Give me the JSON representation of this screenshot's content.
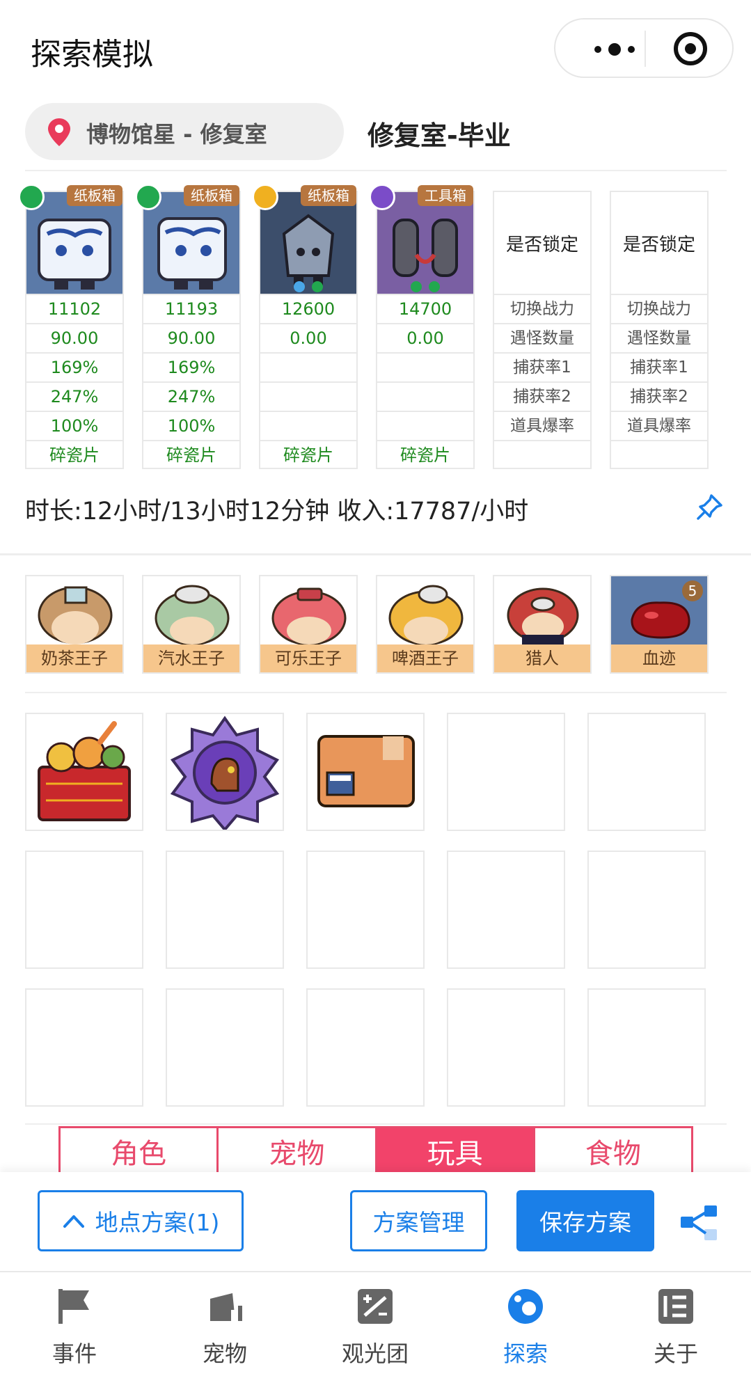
{
  "header": {
    "title": "探索模拟"
  },
  "location": {
    "name": "博物馆星 - 修复室",
    "plan_name": "修复室-毕业"
  },
  "toys": [
    {
      "tag": "纸板箱",
      "rarity_color": "#22a84f",
      "values": [
        "11102",
        "90.00",
        "169%",
        "247%",
        "100%",
        "碎瓷片"
      ]
    },
    {
      "tag": "纸板箱",
      "rarity_color": "#22a84f",
      "values": [
        "11193",
        "90.00",
        "169%",
        "247%",
        "100%",
        "碎瓷片"
      ]
    },
    {
      "tag": "纸板箱",
      "rarity_color": "#f0b020",
      "values": [
        "12600",
        "0.00",
        "",
        "",
        "",
        "碎瓷片"
      ]
    },
    {
      "tag": "工具箱",
      "rarity_color": "#7b4cc8",
      "values": [
        "14700",
        "0.00",
        "",
        "",
        "",
        "碎瓷片"
      ]
    }
  ],
  "lock_columns": [
    {
      "header": "是否锁定",
      "rows": [
        "切换战力",
        "遇怪数量",
        "捕获率1",
        "捕获率2",
        "道具爆率"
      ]
    },
    {
      "header": "是否锁定",
      "rows": [
        "切换战力",
        "遇怪数量",
        "捕获率1",
        "捕获率2",
        "道具爆率"
      ]
    }
  ],
  "status_line": "时长:12小时/13小时12分钟 收入:17787/小时",
  "pets": [
    {
      "label": "奶茶王子"
    },
    {
      "label": "汽水王子"
    },
    {
      "label": "可乐王子"
    },
    {
      "label": "啤酒王子"
    },
    {
      "label": "猎人"
    },
    {
      "label": "血迹",
      "badge": "5"
    }
  ],
  "tabs": [
    {
      "label": "角色",
      "active": false
    },
    {
      "label": "宠物",
      "active": false
    },
    {
      "label": "玩具",
      "active": true
    },
    {
      "label": "食物",
      "active": false
    }
  ],
  "actions": {
    "location_plans": "地点方案(1)",
    "plan_manage": "方案管理",
    "save_plan": "保存方案"
  },
  "nav": [
    {
      "label": "事件",
      "icon": "flag-icon"
    },
    {
      "label": "宠物",
      "icon": "pet-icon"
    },
    {
      "label": "观光团",
      "icon": "tour-icon"
    },
    {
      "label": "探索",
      "icon": "explore-icon",
      "active": true
    },
    {
      "label": "关于",
      "icon": "about-icon"
    }
  ],
  "colors": {
    "accent": "#1a7fe8",
    "tab_accent": "#e84a6c",
    "value_green": "#1e8a1e"
  }
}
